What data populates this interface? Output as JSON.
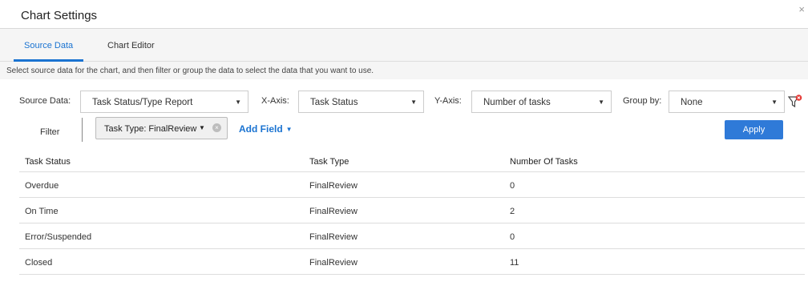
{
  "dialog": {
    "title": "Chart Settings",
    "close_icon": "×"
  },
  "tabs": [
    {
      "label": "Source Data",
      "active": true
    },
    {
      "label": "Chart Editor",
      "active": false
    }
  ],
  "description": "Select source data for the chart, and then filter or group the data to select the data that you want to use.",
  "controls": {
    "source_data": {
      "label": "Source Data:",
      "value": "Task Status/Type Report"
    },
    "x_axis": {
      "label": "X-Axis:",
      "value": "Task Status"
    },
    "y_axis": {
      "label": "Y-Axis:",
      "value": "Number of tasks"
    },
    "group_by": {
      "label": "Group by:",
      "value": "None"
    },
    "dropdown_arrow": "▼"
  },
  "filter": {
    "label": "Filter",
    "chip_value": "Task Type: FinalReview",
    "chip_clear_icon": "×",
    "add_field_label": "Add Field",
    "apply_label": "Apply"
  },
  "table": {
    "columns": [
      "Task Status",
      "Task Type",
      "Number Of Tasks"
    ],
    "rows": [
      [
        "Overdue",
        "FinalReview",
        "0"
      ],
      [
        "On Time",
        "FinalReview",
        "2"
      ],
      [
        "Error/Suspended",
        "FinalReview",
        "0"
      ],
      [
        "Closed",
        "FinalReview",
        "11"
      ]
    ]
  },
  "colors": {
    "accent": "#1a73d1",
    "apply_button": "#2f7ad8",
    "filter_badge": "#e53935"
  }
}
